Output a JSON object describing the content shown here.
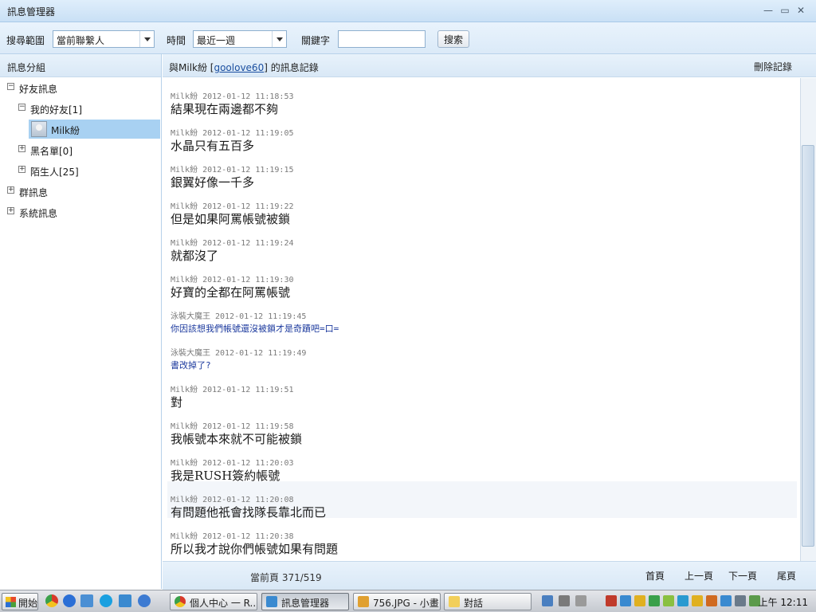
{
  "window": {
    "title": "訊息管理器",
    "controls": [
      "—",
      "▭",
      "✕"
    ]
  },
  "search": {
    "scope_label": "搜尋範圍",
    "scope_value": "當前聯繫人",
    "time_label": "時間",
    "time_value": "最近一週",
    "keyword_label": "關鍵字",
    "keyword_value": "",
    "search_button": "搜索"
  },
  "sidebar": {
    "header": "訊息分組",
    "tree": {
      "friend_msgs": "好友訊息",
      "my_friends": "我的好友[1]",
      "contact": "Milk紛",
      "blacklist": "黑名單[0]",
      "strangers": "陌生人[25]",
      "group_msgs": "群訊息",
      "system_msgs": "系統訊息"
    }
  },
  "main": {
    "caption_prefix": "與Milk紛 [",
    "caption_link": "goolove60",
    "caption_suffix": "] 的訊息記錄",
    "delete_label": "刪除記錄",
    "messages": [
      {
        "sender": "Milk紛",
        "time": "2012-01-12 11:18:53",
        "text": "結果現在兩邊都不夠"
      },
      {
        "sender": "Milk紛",
        "time": "2012-01-12 11:19:05",
        "text": "水晶只有五百多"
      },
      {
        "sender": "Milk紛",
        "time": "2012-01-12 11:19:15",
        "text": "銀翼好像一千多"
      },
      {
        "sender": "Milk紛",
        "time": "2012-01-12 11:19:22",
        "text": "但是如果阿罵帳號被鎖"
      },
      {
        "sender": "Milk紛",
        "time": "2012-01-12 11:19:24",
        "text": "就都沒了"
      },
      {
        "sender": "Milk紛",
        "time": "2012-01-12 11:19:30",
        "text": "好寶的全都在阿罵帳號"
      },
      {
        "sender": "泳裝大魔王",
        "time": "2012-01-12 11:19:45",
        "text": "你因該想我們帳號還沒被鎖才是奇蹟吧=口="
      },
      {
        "sender": "泳裝大魔王",
        "time": "2012-01-12 11:19:49",
        "text": "書改掉了?"
      },
      {
        "sender": "Milk紛",
        "time": "2012-01-12 11:19:51",
        "text": "對"
      },
      {
        "sender": "Milk紛",
        "time": "2012-01-12 11:19:58",
        "text": "我帳號本來就不可能被鎖"
      },
      {
        "sender": "Milk紛",
        "time": "2012-01-12 11:20:03",
        "text": "我是RUSH簽約帳號"
      },
      {
        "sender": "Milk紛",
        "time": "2012-01-12 11:20:08",
        "text": "有問題他祇會找隊長靠北而已"
      },
      {
        "sender": "Milk紛",
        "time": "2012-01-12 11:20:38",
        "text": "所以我才說你們帳號如果有問題"
      }
    ]
  },
  "pager": {
    "current": "當前頁 371/519",
    "first": "首頁",
    "prev": "上一頁",
    "next": "下一頁",
    "last": "尾頁"
  },
  "taskbar": {
    "start": "開始",
    "tasks": [
      "個人中心 一 R...",
      "訊息管理器",
      "756.JPG - 小畫...",
      "對話"
    ],
    "clock": "上午 12:11"
  }
}
